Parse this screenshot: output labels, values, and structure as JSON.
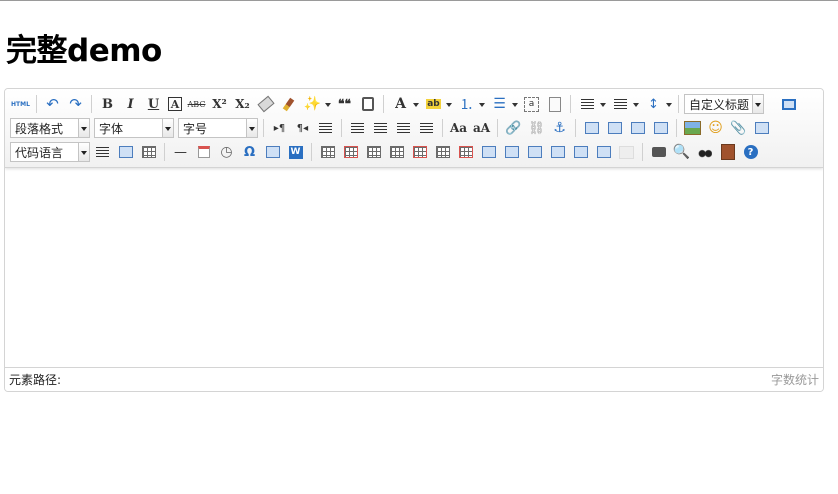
{
  "page": {
    "title": "完整demo"
  },
  "toolbar": {
    "html_label": "HTML",
    "bold": "B",
    "italic": "I",
    "underline": "U",
    "font_border": "A",
    "strike": "ABC",
    "superscript": "X²",
    "subscript": "X₂",
    "blockquote": "❝❝",
    "forecolor": "A",
    "custom_title": "自定义标题",
    "paragraph_format": "段落格式",
    "font_family": "字体",
    "font_size": "字号",
    "code_language": "代码语言",
    "ltr": "▸¶",
    "rtl": "¶◂",
    "omega": "Ω",
    "hr": "—"
  },
  "statusbar": {
    "element_path": "元素路径:",
    "word_count": "字数统计"
  }
}
